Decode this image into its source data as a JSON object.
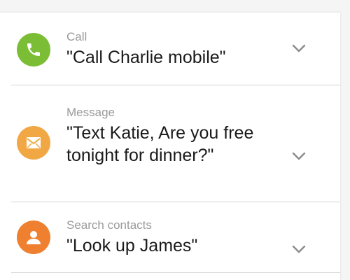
{
  "items": [
    {
      "category": "Call",
      "utterance": "\"Call Charlie mobile\"",
      "icon": "phone-icon",
      "color": "#7bbe36"
    },
    {
      "category": "Message",
      "utterance": "\"Text Katie, Are you free tonight for dinner?\"",
      "icon": "envelope-icon",
      "color": "#f1a844"
    },
    {
      "category": "Search contacts",
      "utterance": "\"Look up James\"",
      "icon": "person-icon",
      "color": "#ee8030"
    }
  ]
}
